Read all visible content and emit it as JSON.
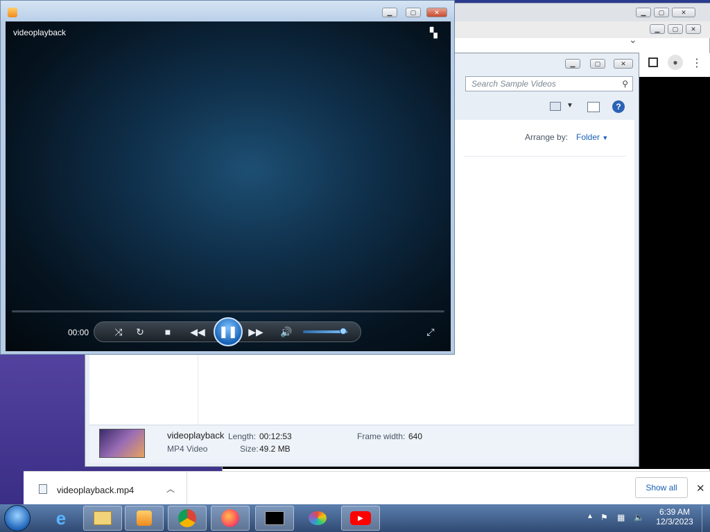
{
  "player": {
    "title": "videoplayback",
    "time": "00:00",
    "volume": 0.9
  },
  "explorer": {
    "search_placeholder": "Search Sample Videos",
    "arrange_label": "Arrange by:",
    "arrange_value": "Folder",
    "details": {
      "name": "videoplayback",
      "type": "MP4 Video",
      "length_label": "Length:",
      "length_value": "00:12:53",
      "size_label": "Size:",
      "size_value": "49.2 MB",
      "frame_width_label": "Frame width:",
      "frame_width_value": "640"
    }
  },
  "download_bar": {
    "file_name": "videoplayback.mp4",
    "show_all": "Show all"
  },
  "taskbar": {
    "time": "6:39 AM",
    "date": "12/3/2023"
  },
  "colors": {
    "accent": "#1a5fb4",
    "taskbar": "#2f4a73",
    "player_bg": "#0f2f4a"
  }
}
